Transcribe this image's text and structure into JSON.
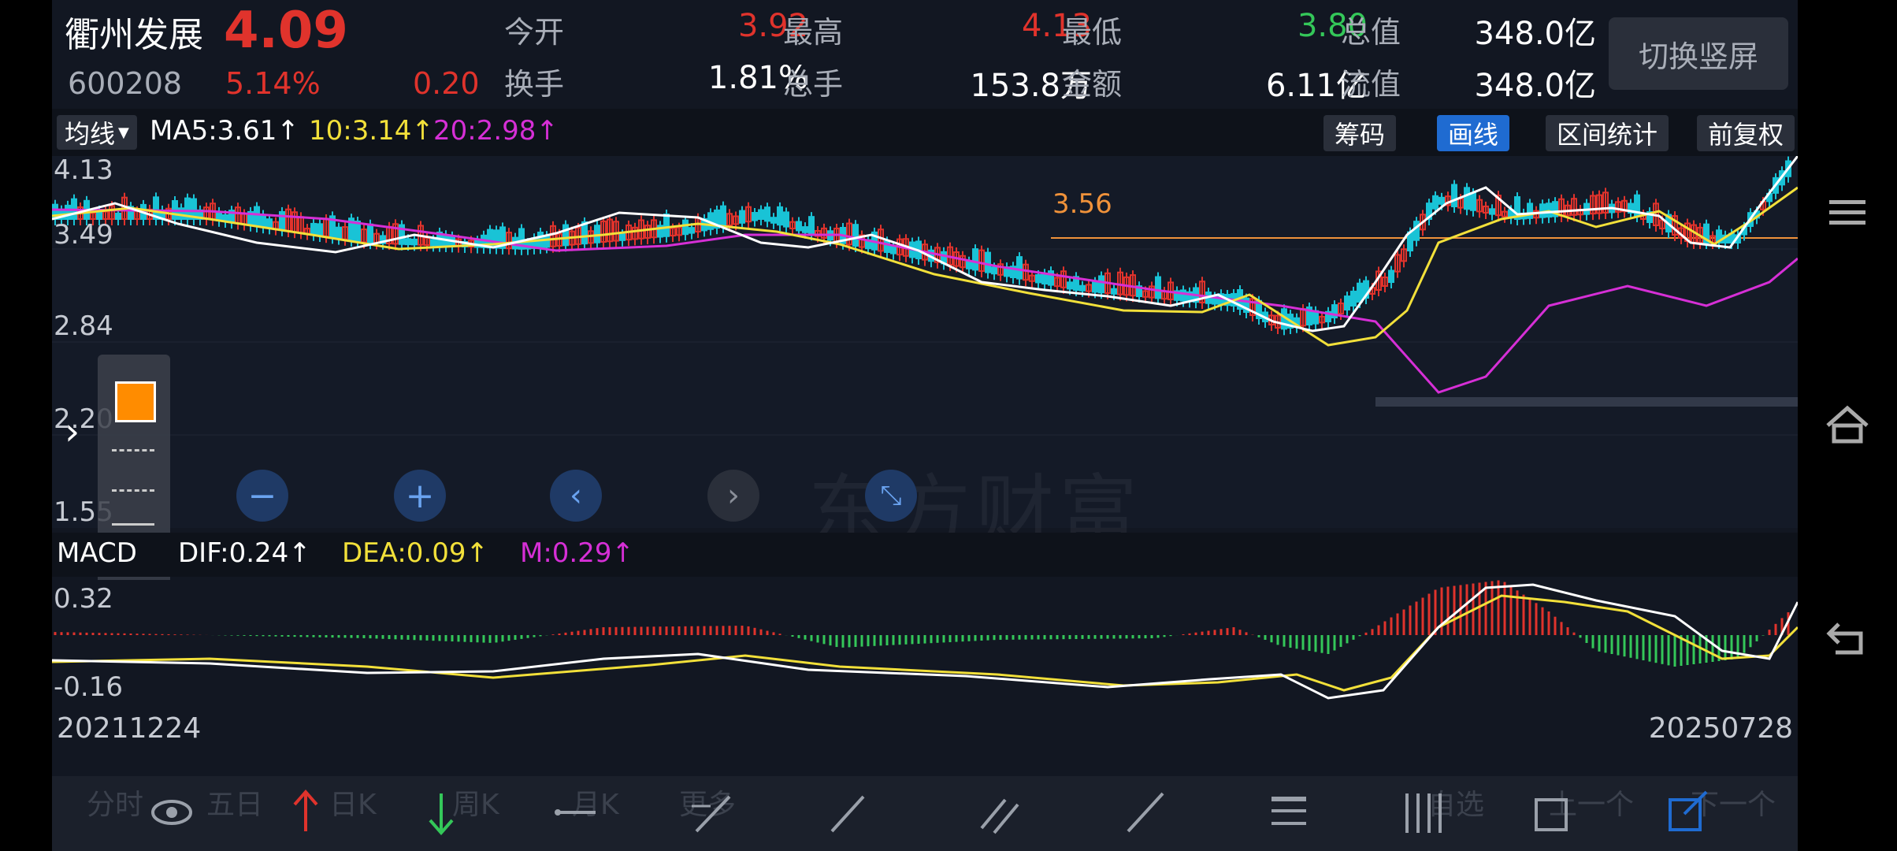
{
  "header": {
    "name": "衢州发展",
    "price": "4.09",
    "code": "600208",
    "pct": "5.14%",
    "change": "0.20",
    "quotes": [
      {
        "label": "今开",
        "value": "3.92",
        "color": "#e0332c"
      },
      {
        "label": "最高",
        "value": "4.13",
        "color": "#e0332c"
      },
      {
        "label": "最低",
        "value": "3.80",
        "color": "#34c759"
      },
      {
        "label": "总值",
        "value": "348.0亿",
        "color": "#ffffff"
      },
      {
        "label": "换手",
        "value": "1.81%",
        "color": "#ffffff"
      },
      {
        "label": "总手",
        "value": "153.8万",
        "color": "#ffffff"
      },
      {
        "label": "金额",
        "value": "6.11亿",
        "color": "#ffffff"
      },
      {
        "label": "流值",
        "value": "348.0亿",
        "color": "#ffffff"
      }
    ],
    "switch_label": "切换竖屏"
  },
  "ma_bar": {
    "dropdown": "均线",
    "ma5": "MA5:3.61↑",
    "ma10": "10:3.14↑",
    "ma20": "20:2.98↑",
    "buttons": [
      "筹码",
      "画线",
      "区间统计",
      "前复权"
    ]
  },
  "price_axis": {
    "top": "4.13",
    "second": "3.49",
    "third": "2.84",
    "fourth": "2.20",
    "bottom": "1.55"
  },
  "ref_line": "3.56",
  "watermark": "东方财富",
  "macd_bar": {
    "name": "MACD",
    "dif": "DIF:0.24↑",
    "dea": "DEA:0.09↑",
    "m": "M:0.29↑",
    "axis_top": "0.32",
    "axis_bottom": "-0.16"
  },
  "dates": {
    "start": "20211224",
    "end": "20250728"
  },
  "bottom_tabs": [
    "分时",
    "五日",
    "日K",
    "周K",
    "月K",
    "更多",
    "自选",
    "上一个",
    "下一个"
  ],
  "colors": {
    "up": "#e0332c",
    "down": "#19c3d6",
    "ma5": "#ffffff",
    "ma10": "#f2e03a",
    "ma20": "#d62fd6",
    "ref": "#f0923a",
    "active": "#1f6bd1"
  }
}
